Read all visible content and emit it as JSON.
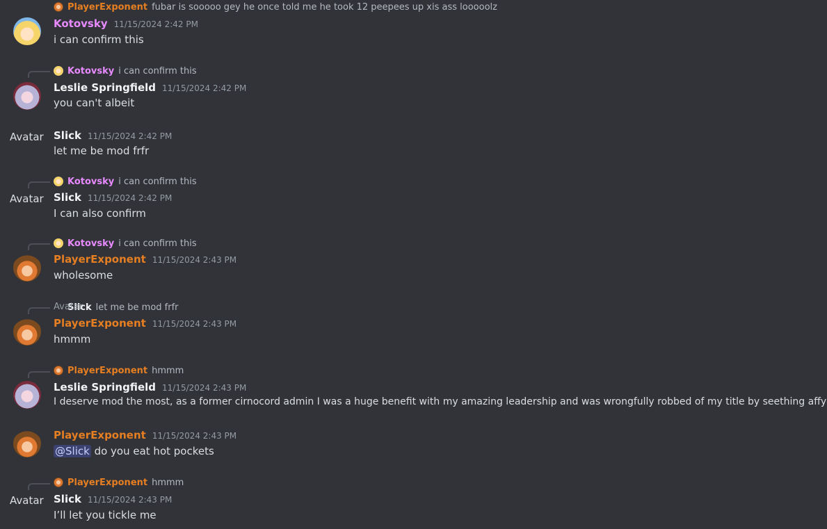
{
  "messages": [
    {
      "reply": {
        "name": "PlayerExponent",
        "text": "fubar is sooooo gey he once told me he took 12 peepees up xis ass looooolz"
      },
      "avatar": "kotovsky-avatar",
      "user": "Kotovsky",
      "time": "11/15/2024 2:42 PM",
      "text": "i can confirm this"
    },
    {
      "reply": {
        "name": "Kotovsky",
        "text": "i can confirm this"
      },
      "avatar": "leslie-avatar",
      "user": "Leslie Springfield",
      "time": "11/15/2024 2:42 PM",
      "text": "you can't albeit"
    },
    {
      "avatar_alt": "Avatar",
      "user": "Slick",
      "time": "11/15/2024 2:42 PM",
      "text": "let me be mod frfr"
    },
    {
      "reply": {
        "name": "Kotovsky",
        "text": "i can confirm this"
      },
      "avatar_alt": "Avatar",
      "user": "Slick",
      "time": "11/15/2024 2:42 PM",
      "text": "I can also confirm"
    },
    {
      "reply": {
        "name": "Kotovsky",
        "text": "i can confirm this"
      },
      "avatar": "playerexponent-avatar",
      "user": "PlayerExponent",
      "time": "11/15/2024 2:43 PM",
      "text": "wholesome"
    },
    {
      "reply": {
        "avatar_alt": "Avatar",
        "name": "Slick",
        "text": "let me be mod frfr"
      },
      "avatar": "playerexponent-avatar",
      "user": "PlayerExponent",
      "time": "11/15/2024 2:43 PM",
      "text": "hmmm"
    },
    {
      "reply": {
        "name": "PlayerExponent",
        "text": "hmmm"
      },
      "avatar": "leslie-avatar",
      "user": "Leslie Springfield",
      "time": "11/15/2024 2:43 PM",
      "text": "I deserve mod the most, as a former cirnocord admin I was a huge benefit with my amazing leadership and was wrongfully robbed of my title by seething affycucks"
    },
    {
      "avatar": "playerexponent-avatar",
      "user": "PlayerExponent",
      "time": "11/15/2024 2:43 PM",
      "mention": "@Slick",
      "text": " do you eat hot pockets"
    },
    {
      "reply": {
        "name": "PlayerExponent",
        "text": "hmmm"
      },
      "avatar_alt": "Avatar",
      "user": "Slick",
      "time": "11/15/2024 2:43 PM",
      "text": "I’ll let you tickle me"
    }
  ],
  "colors": {
    "background": "#313338",
    "kotovsky": "#f47fff",
    "playerexponent": "#e67e22",
    "leslie": "#f2f3f5",
    "slick": "#f2f3f5",
    "timestamp": "#949ba4",
    "mention_bg": "#3c4270"
  }
}
